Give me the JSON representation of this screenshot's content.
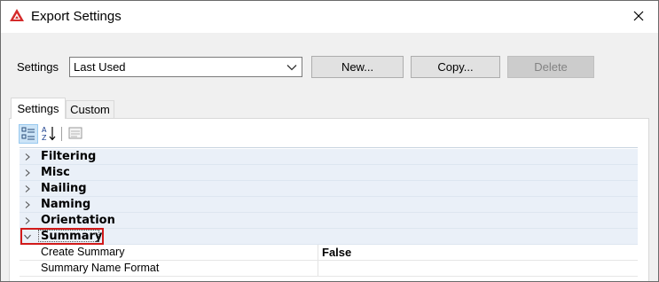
{
  "window": {
    "title": "Export Settings"
  },
  "settings_row": {
    "label": "Settings",
    "selected": "Last Used",
    "buttons": {
      "new": "New...",
      "copy": "Copy...",
      "delete": "Delete"
    }
  },
  "tabs": [
    {
      "label": "Settings",
      "active": true
    },
    {
      "label": "Custom",
      "active": false
    }
  ],
  "toolbar": {
    "categorized_icon": "categorized-view-icon",
    "alphabetical_icon": "alphabetical-sort-icon",
    "pages_icon": "property-pages-icon"
  },
  "categories": [
    {
      "label": "Filtering",
      "expanded": false
    },
    {
      "label": "Misc",
      "expanded": false
    },
    {
      "label": "Nailing",
      "expanded": false
    },
    {
      "label": "Naming",
      "expanded": false
    },
    {
      "label": "Orientation",
      "expanded": false
    },
    {
      "label": "Summary",
      "expanded": true
    }
  ],
  "summary_properties": [
    {
      "name": "Create Summary",
      "value": "False"
    },
    {
      "name": "Summary Name Format",
      "value": ""
    }
  ],
  "colors": {
    "highlight": "#d11a1a",
    "category_bg": "#eaf0f8"
  }
}
